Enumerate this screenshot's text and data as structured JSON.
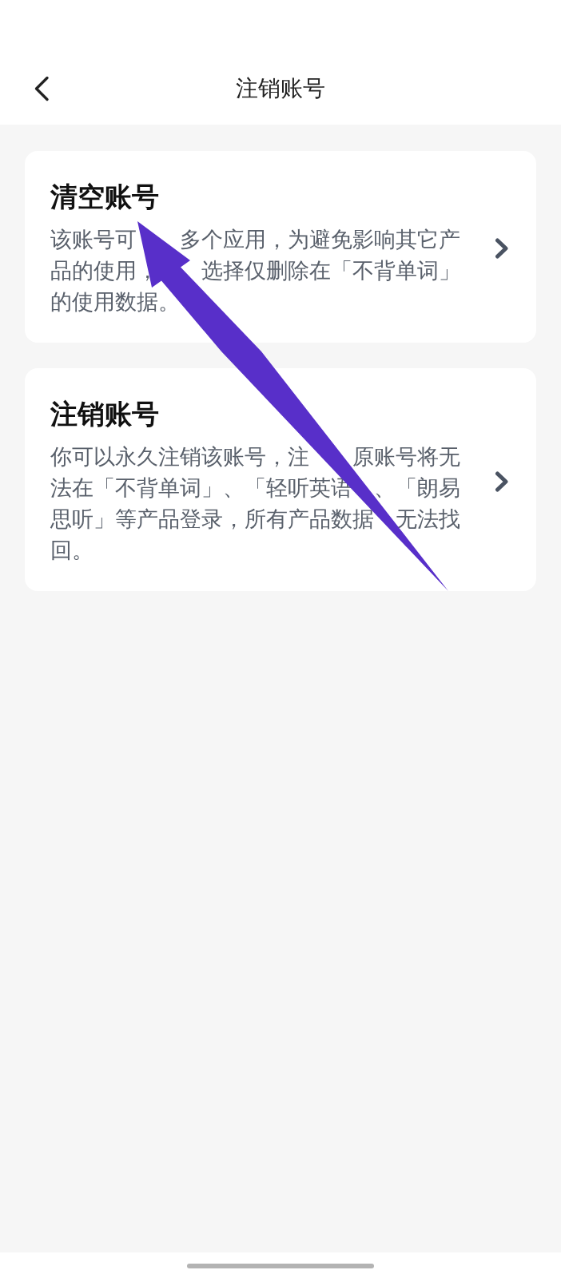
{
  "header": {
    "title": "注销账号"
  },
  "options": [
    {
      "title": "清空账号",
      "description": "该账号可　　多个应用，为避免影响其它产品的使用，　　选择仅删除在「不背单词」的使用数据。"
    },
    {
      "title": "注销账号",
      "description": "你可以永久注销该账号，注　　原账号将无法在「不背单词」、「轻听英语　、「朗易思听」等产品登录，所有产品数据　无法找回。"
    }
  ]
}
